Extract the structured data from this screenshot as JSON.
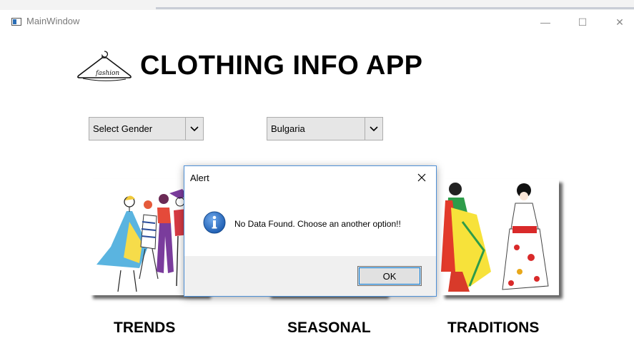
{
  "window": {
    "title": "MainWindow",
    "minimize_glyph": "—",
    "maximize_glyph": "☐",
    "close_glyph": "✕"
  },
  "header": {
    "title": "CLOTHING INFO APP",
    "logo_icon": "fashion-hanger-icon"
  },
  "filters": {
    "gender": {
      "selected": "Select Gender"
    },
    "country": {
      "selected": "Bulgaria"
    }
  },
  "categories": [
    {
      "label": "TRENDS",
      "image_icon": "fashion-women-sketch"
    },
    {
      "label": "SEASONAL",
      "image_icon": "seasonal-image"
    },
    {
      "label": "TRADITIONS",
      "image_icon": "saree-kimono-figures"
    }
  ],
  "dialog": {
    "title": "Alert",
    "message": "No Data Found. Choose an another option!!",
    "ok_label": "OK",
    "icon": "info-icon"
  },
  "colors": {
    "dialog_border": "#4d8fd6",
    "focus_accent": "#0078d7",
    "info_blue": "#1f5fb3"
  }
}
